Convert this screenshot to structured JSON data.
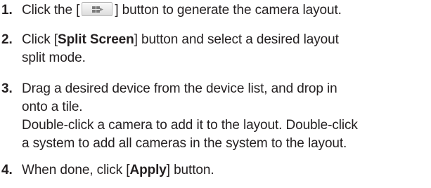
{
  "steps": [
    {
      "number": "1.",
      "pre": "Click the [",
      "button_icon": "camera-layout-icon",
      "post": "] button to generate the camera layout."
    },
    {
      "number": "2.",
      "pre": "Click [",
      "bold": "Split Screen",
      "post": "] button and select a desired layout",
      "line2": "split mode."
    },
    {
      "number": "3.",
      "line1": "Drag a desired device from the device list, and drop in",
      "line2": "onto a tile.",
      "line3": "Double-click a camera to add it to the layout. Double-click",
      "line4": "a system to add all cameras in the system to the layout."
    },
    {
      "number": "4.",
      "pre": "When done, click [",
      "bold": "Apply",
      "post": "] button."
    }
  ]
}
